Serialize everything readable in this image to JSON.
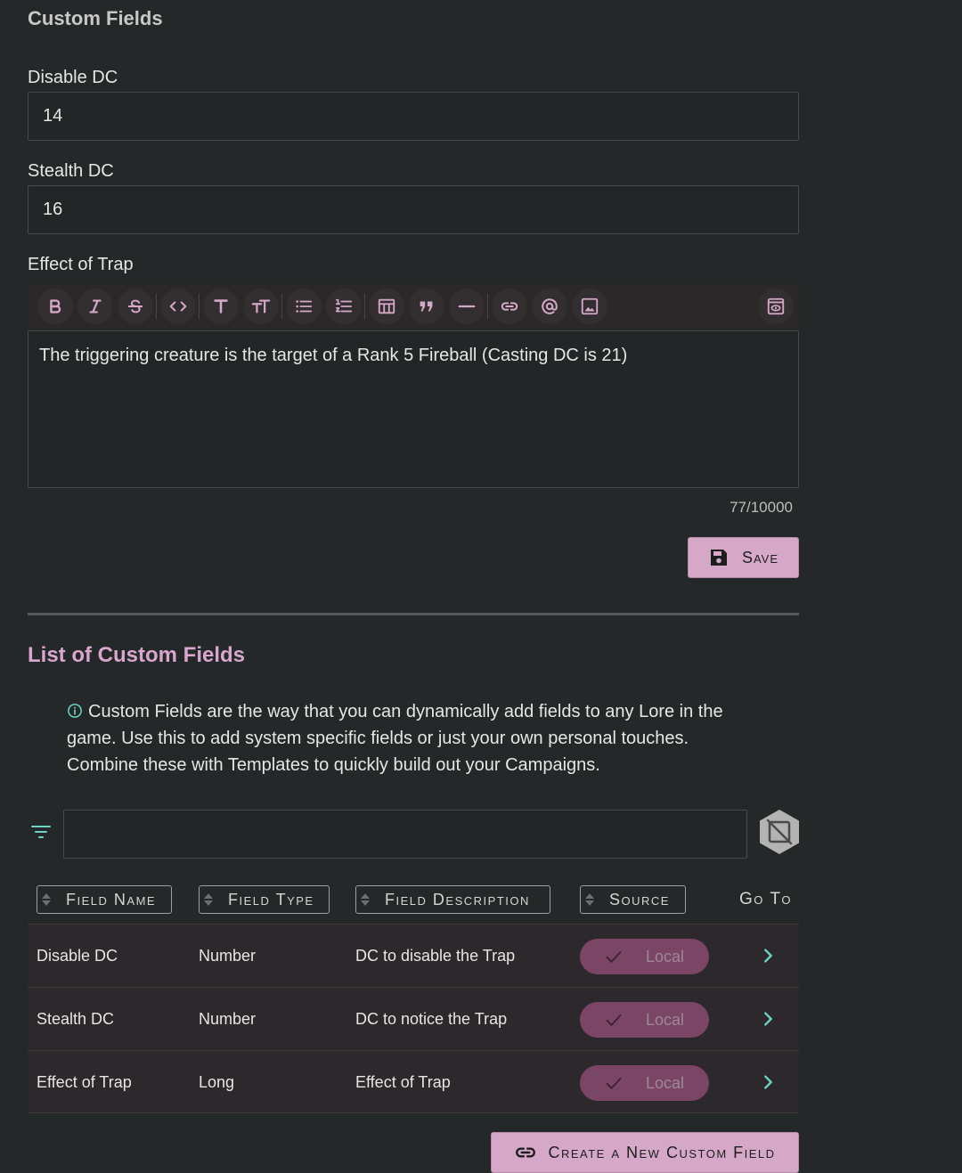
{
  "custom_fields": {
    "title": "Custom Fields",
    "fields": [
      {
        "label": "Disable DC",
        "value": "14"
      },
      {
        "label": "Stealth DC",
        "value": "16"
      }
    ],
    "effect": {
      "label": "Effect of Trap",
      "value": "The triggering creature is the target of a Rank 5 Fireball (Casting DC is 21)",
      "counter": "77/10000"
    },
    "toolbar_icons": [
      "bold-icon",
      "italic-icon",
      "strikethrough-icon",
      "code-icon",
      "heading-icon",
      "text-size-icon",
      "bullet-list-icon",
      "numbered-list-icon",
      "table-icon",
      "quote-icon",
      "horizontal-rule-icon",
      "link-icon",
      "mention-icon",
      "image-icon",
      "preview-icon"
    ],
    "save_label": "Save",
    "accent_color": "#d5a8c8"
  },
  "list": {
    "title": "List of Custom Fields",
    "info": "Custom Fields are the way that you can dynamically add fields to any Lore in the game. Use this to add system specific fields or just your own personal touches. Combine these with Templates to quickly build out your Campaigns.",
    "filter_value": "",
    "columns": {
      "name": "Field Name",
      "type": "Field Type",
      "description": "Field Description",
      "source": "Source",
      "goto": "Go To"
    },
    "rows": [
      {
        "name": "Disable DC",
        "type": "Number",
        "description": "DC to disable the Trap",
        "source": "Local"
      },
      {
        "name": "Stealth DC",
        "type": "Number",
        "description": "DC to notice the Trap",
        "source": "Local"
      },
      {
        "name": "Effect of Trap",
        "type": "Long",
        "description": "Effect of Trap",
        "source": "Local"
      }
    ],
    "create_label": "Create a New Custom Field",
    "chip_color": "#7b4566"
  }
}
